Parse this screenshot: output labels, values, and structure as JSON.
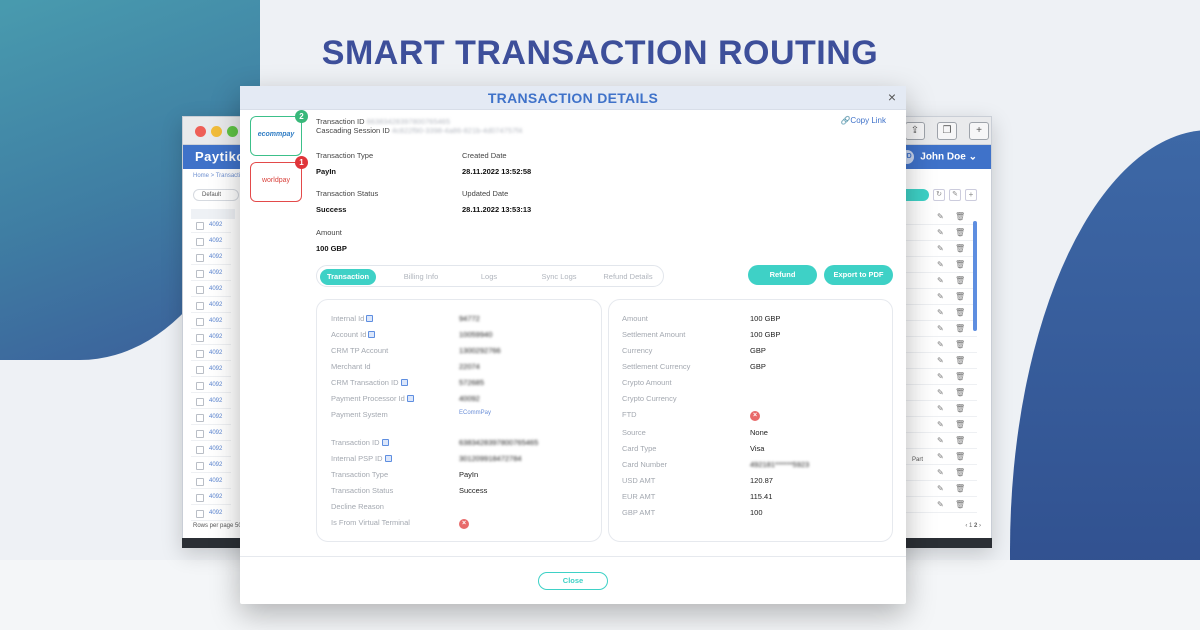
{
  "headline": "SMART TRANSACTION ROUTING",
  "browser": {
    "brand": "Paytiko",
    "user_initials": "JD",
    "user_name": "John Doe",
    "breadcrumb": "Home > Transactions",
    "filter_default": "Default",
    "row_id_prefix": "4092",
    "rows_per_page_label": "Rows per page",
    "rows_per_page_value": "50",
    "page_current": "2",
    "row_status": "Part"
  },
  "modal": {
    "title": "TRANSACTION DETAILS",
    "close_icon": "×",
    "copy_link": "Copy Link",
    "transaction_id_label": "Transaction ID",
    "transaction_id_value": "66383428397800765465",
    "cascading_session_label": "Cascading Session ID",
    "cascading_session_value": "4c822f90-3398-4a86-821b-4d074757f4",
    "processors": [
      {
        "name": "ecommpay",
        "badge": "2",
        "status": "success"
      },
      {
        "name": "worldpay",
        "badge": "1",
        "status": "failed"
      }
    ],
    "summary": {
      "transaction_type_label": "Transaction Type",
      "transaction_type_value": "PayIn",
      "created_date_label": "Created Date",
      "created_date_value": "28.11.2022 13:52:58",
      "transaction_status_label": "Transaction Status",
      "transaction_status_value": "Success",
      "updated_date_label": "Updated Date",
      "updated_date_value": "28.11.2022 13:53:13",
      "amount_label": "Amount",
      "amount_value": "100 GBP"
    },
    "tabs": [
      "Transaction",
      "Billing Info",
      "Logs",
      "Sync Logs",
      "Refund Details"
    ],
    "active_tab": "Transaction",
    "refund_button": "Refund",
    "export_button": "Export to PDF",
    "left_panel": [
      {
        "label": "Internal Id",
        "value": "94772",
        "copy": true
      },
      {
        "label": "Account Id",
        "value": "10059940",
        "copy": true
      },
      {
        "label": "CRM TP Account",
        "value": "1300292766",
        "copy": false
      },
      {
        "label": "Merchant Id",
        "value": "22074",
        "copy": false
      },
      {
        "label": "CRM Transaction ID",
        "value": "572685",
        "copy": true
      },
      {
        "label": "Payment Processor Id",
        "value": "40092",
        "copy": true
      },
      {
        "label": "Payment System",
        "value": "ECommPay",
        "copy": false
      },
      {
        "label": "Transaction ID",
        "value": "6383428397800765465",
        "copy": true
      },
      {
        "label": "Internal PSP ID",
        "value": "301209918472784",
        "copy": true
      },
      {
        "label": "Transaction Type",
        "value": "PayIn",
        "copy": false
      },
      {
        "label": "Transaction Status",
        "value": "Success",
        "copy": false
      },
      {
        "label": "Decline Reason",
        "value": "",
        "copy": false
      },
      {
        "label": "Is From Virtual Terminal",
        "value": "",
        "copy": false
      }
    ],
    "right_panel": [
      {
        "label": "Amount",
        "value": "100 GBP"
      },
      {
        "label": "Settlement Amount",
        "value": "100 GBP"
      },
      {
        "label": "Currency",
        "value": "GBP"
      },
      {
        "label": "Settlement Currency",
        "value": "GBP"
      },
      {
        "label": "Crypto Amount",
        "value": ""
      },
      {
        "label": "Crypto Currency",
        "value": ""
      },
      {
        "label": "FTD",
        "value": ""
      },
      {
        "label": "Source",
        "value": "None"
      },
      {
        "label": "Card Type",
        "value": "Visa"
      },
      {
        "label": "Card Number",
        "value": "492181******5923"
      },
      {
        "label": "USD AMT",
        "value": "120.87"
      },
      {
        "label": "EUR AMT",
        "value": "115.41"
      },
      {
        "label": "GBP AMT",
        "value": "100"
      }
    ],
    "close_button": "Close"
  },
  "colors": {
    "accent": "#3ed1c6",
    "brand_blue": "#3f72c9",
    "headline": "#3d4f9a",
    "error": "#e0353a",
    "success": "#38b87a"
  }
}
